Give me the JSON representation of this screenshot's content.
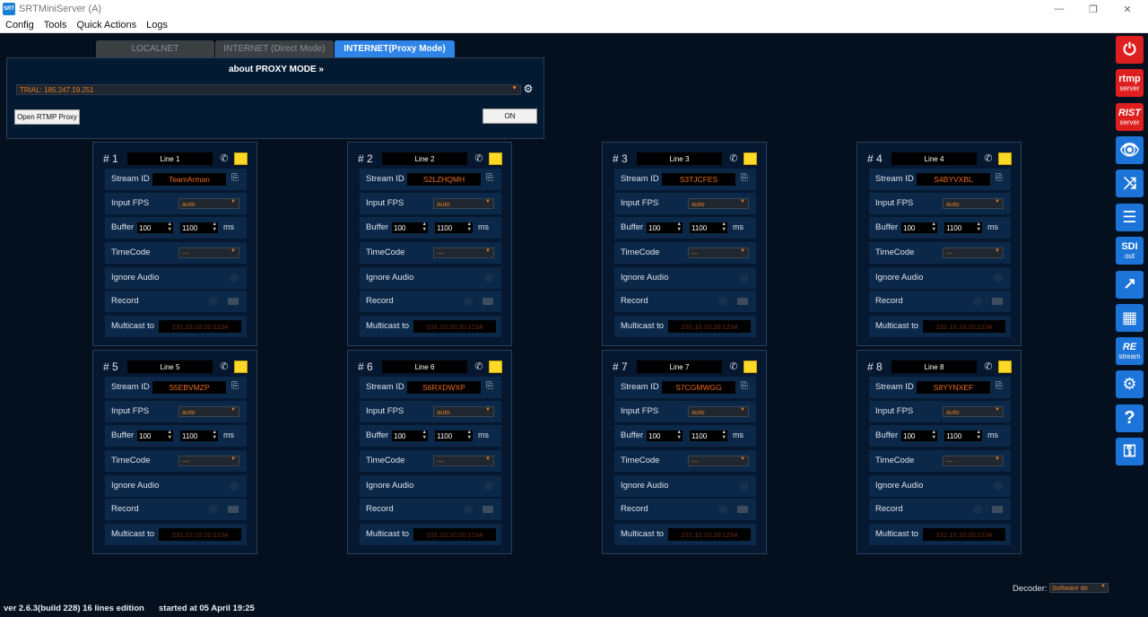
{
  "window": {
    "title": "SRTMiniServer (A)",
    "app_icon": "srt-app-icon",
    "controls": {
      "minimize": "—",
      "maximize": "❐",
      "close": "✕"
    }
  },
  "menu": [
    "Config",
    "Tools",
    "Quick Actions",
    "Logs"
  ],
  "tabs": [
    {
      "label": "LOCALNET",
      "active": false
    },
    {
      "label": "INTERNET (Direct Mode)",
      "active": false
    },
    {
      "label": "INTERNET(Proxy Mode)",
      "active": true
    }
  ],
  "proxy": {
    "about_label": "about PROXY MODE »",
    "server_value": "TRIAL: 185.247.19.251",
    "open_rtmp_label": "Open RTMP Proxy",
    "on_label": "ON"
  },
  "card_labels": {
    "stream_id": "Stream ID",
    "input_fps": "Input FPS",
    "buffer": "Buffer",
    "ms": "ms",
    "timecode": "TimeCode",
    "ignore_audio": "Ignore Audio",
    "record": "Record",
    "multicast_to": "Multicast to"
  },
  "lines": [
    {
      "num": "# 1",
      "name": "Line 1",
      "stream_id": "TeamArman",
      "fps": "auto",
      "buffer_min": "100",
      "buffer_max": "1100",
      "timecode": "---",
      "multicast": "231.10.10.20:1234"
    },
    {
      "num": "# 2",
      "name": "Line 2",
      "stream_id": "S2LZHQMH",
      "fps": "auto",
      "buffer_min": "100",
      "buffer_max": "1100",
      "timecode": "---",
      "multicast": "231.10.10.20:1234"
    },
    {
      "num": "# 3",
      "name": "Line 3",
      "stream_id": "S3TJCFES",
      "fps": "auto",
      "buffer_min": "100",
      "buffer_max": "1100",
      "timecode": "---",
      "multicast": "231.10.10.20:1234"
    },
    {
      "num": "# 4",
      "name": "Line 4",
      "stream_id": "S4BYVXBL",
      "fps": "auto",
      "buffer_min": "100",
      "buffer_max": "1100",
      "timecode": "---",
      "multicast": "231.10.10.20:1234"
    },
    {
      "num": "# 5",
      "name": "Line 5",
      "stream_id": "S5EBVMZP",
      "fps": "auto",
      "buffer_min": "100",
      "buffer_max": "1100",
      "timecode": "---",
      "multicast": "231.10.10.20:1234"
    },
    {
      "num": "# 6",
      "name": "Line 6",
      "stream_id": "S6RXDWXP",
      "fps": "auto",
      "buffer_min": "100",
      "buffer_max": "1100",
      "timecode": "---",
      "multicast": "231.10.10.20:1234"
    },
    {
      "num": "# 7",
      "name": "Line 7",
      "stream_id": "S7CGMWGG",
      "fps": "auto",
      "buffer_min": "100",
      "buffer_max": "1100",
      "timecode": "---",
      "multicast": "231.10.10.20:1234"
    },
    {
      "num": "# 8",
      "name": "Line 8",
      "stream_id": "S8YYNXEF",
      "fps": "auto",
      "buffer_min": "100",
      "buffer_max": "1100",
      "timecode": "---",
      "multicast": "231.10.10.20:1234"
    }
  ],
  "sidebar": [
    {
      "name": "power-button",
      "icon": "power-icon",
      "glyph": "⏻",
      "text": "",
      "sub": "",
      "color": "red"
    },
    {
      "name": "rtmp-server-button",
      "icon": "",
      "glyph": "",
      "text": "rtmp",
      "sub": "server",
      "color": "red"
    },
    {
      "name": "rist-server-button",
      "icon": "",
      "glyph": "",
      "text": "RIST",
      "sub": "server",
      "color": "red"
    },
    {
      "name": "preview-button",
      "icon": "image-eye-icon",
      "glyph": "👁",
      "text": "",
      "sub": "",
      "color": "blue"
    },
    {
      "name": "route-button",
      "icon": "shuffle-icon",
      "glyph": "⤨",
      "text": "",
      "sub": "",
      "color": "blue"
    },
    {
      "name": "schedule-button",
      "icon": "list-clock-icon",
      "glyph": "☰",
      "text": "",
      "sub": "",
      "color": "blue"
    },
    {
      "name": "sdi-out-button",
      "icon": "",
      "glyph": "",
      "text": "SDI",
      "sub": "out",
      "color": "blue"
    },
    {
      "name": "share-button",
      "icon": "share-icon",
      "glyph": "↗",
      "text": "",
      "sub": "",
      "color": "blue"
    },
    {
      "name": "users-button",
      "icon": "users-grid-icon",
      "glyph": "▦",
      "text": "",
      "sub": "",
      "color": "blue"
    },
    {
      "name": "restream-button",
      "icon": "",
      "glyph": "",
      "text": "RE",
      "sub": "stream",
      "color": "blue"
    },
    {
      "name": "settings-button",
      "icon": "gear-icon",
      "glyph": "⚙",
      "text": "",
      "sub": "",
      "color": "blue"
    },
    {
      "name": "help-button",
      "icon": "question-icon",
      "glyph": "?",
      "text": "",
      "sub": "",
      "color": "blue"
    },
    {
      "name": "license-button",
      "icon": "key-icon",
      "glyph": "⚿",
      "text": "",
      "sub": "",
      "color": "blue"
    }
  ],
  "footer": {
    "version": "ver 2.6.3(build 228) 16 lines edition",
    "started": "started at 05 April 19:25",
    "decoder_label": "Decoder:",
    "decoder_value": "Software de"
  },
  "colors": {
    "accent": "#2e84e8",
    "stream_id_text": "#e86a24",
    "sidebar_red": "#dd1f1f",
    "sidebar_blue": "#1d74d8",
    "status_yellow": "#ffd928"
  }
}
